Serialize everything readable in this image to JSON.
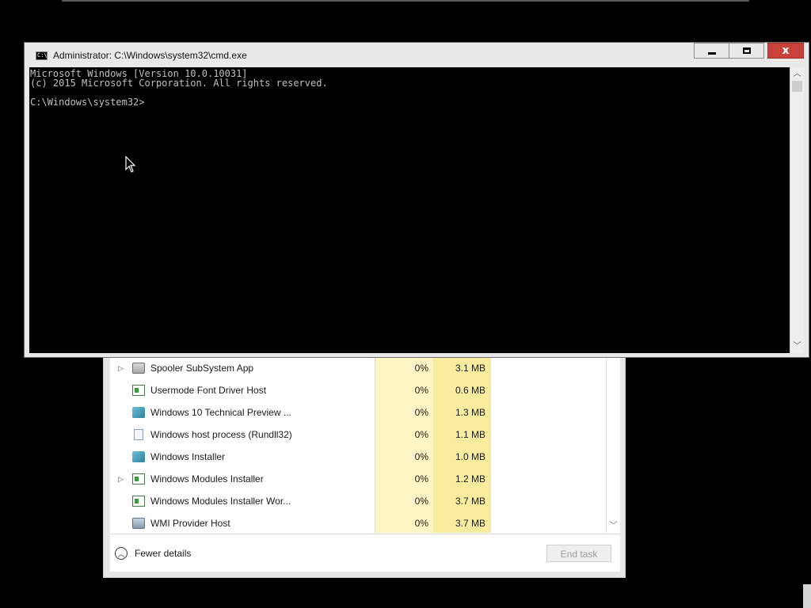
{
  "cmd_window": {
    "title": "Administrator: C:\\Windows\\system32\\cmd.exe",
    "icon_text": "C:\\",
    "buttons": {
      "minimize": "minimize-icon",
      "maximize": "maximize-icon",
      "close_glyph": "x"
    },
    "console_text": "Microsoft Windows [Version 10.0.10031]\n(c) 2015 Microsoft Corporation. All rights reserved.\n\nC:\\Windows\\system32>"
  },
  "task_manager": {
    "processes": [
      {
        "expandable": true,
        "expand_glyph": "▷",
        "icon": "printer-icon",
        "name": "Spooler SubSystem App",
        "cpu": "0%",
        "memory": "3.1 MB"
      },
      {
        "expandable": false,
        "expand_glyph": "",
        "icon": "service-icon",
        "name": "Usermode Font Driver Host",
        "cpu": "0%",
        "memory": "0.6 MB"
      },
      {
        "expandable": false,
        "expand_glyph": "",
        "icon": "installer-icon",
        "name": "Windows 10 Technical Preview ...",
        "cpu": "0%",
        "memory": "1.3 MB"
      },
      {
        "expandable": false,
        "expand_glyph": "",
        "icon": "document-icon",
        "name": "Windows host process (Rundll32)",
        "cpu": "0%",
        "memory": "1.1 MB"
      },
      {
        "expandable": false,
        "expand_glyph": "",
        "icon": "installer-icon",
        "name": "Windows Installer",
        "cpu": "0%",
        "memory": "1.0 MB"
      },
      {
        "expandable": true,
        "expand_glyph": "▷",
        "icon": "service-icon",
        "name": "Windows Modules Installer",
        "cpu": "0%",
        "memory": "1.2 MB"
      },
      {
        "expandable": false,
        "expand_glyph": "",
        "icon": "service-icon",
        "name": "Windows Modules Installer Wor...",
        "cpu": "0%",
        "memory": "3.7 MB"
      },
      {
        "expandable": false,
        "expand_glyph": "",
        "icon": "wmi-icon",
        "name": "WMI Provider Host",
        "cpu": "0%",
        "memory": "3.7 MB"
      }
    ],
    "fewer_details_label": "Fewer details",
    "fewer_details_glyph": "︿",
    "end_task_label": "End task",
    "scroll_down_glyph": "﹀"
  },
  "scrollbar_glyphs": {
    "up": "︿",
    "down": "﹀"
  },
  "colors": {
    "cpu_column": "#fff4c4",
    "memory_column": "#f9ec9e",
    "close_button": "#c8413a",
    "console_bg": "#000000",
    "console_text": "#c0c0c0"
  }
}
